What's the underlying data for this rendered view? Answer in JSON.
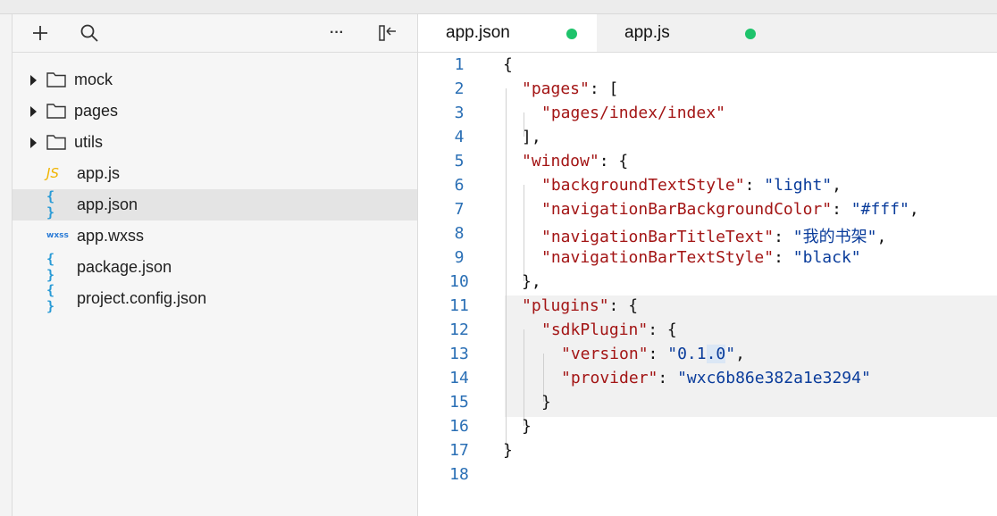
{
  "sidebar": {
    "toolbar": {
      "add_icon": "plus-icon",
      "search_icon": "search-icon",
      "more_label": "···",
      "collapse_label": "▯⇠"
    },
    "items": [
      {
        "label": "mock",
        "type": "folder"
      },
      {
        "label": "pages",
        "type": "folder"
      },
      {
        "label": "utils",
        "type": "folder"
      },
      {
        "label": "app.js",
        "type": "js",
        "icon_text": "JS"
      },
      {
        "label": "app.json",
        "type": "json",
        "icon_text": "{ }",
        "selected": true
      },
      {
        "label": "app.wxss",
        "type": "wxss",
        "icon_text": "wxss"
      },
      {
        "label": "package.json",
        "type": "json",
        "icon_text": "{ }"
      },
      {
        "label": "project.config.json",
        "type": "json",
        "icon_text": "{ }"
      }
    ]
  },
  "editor": {
    "tabs": [
      {
        "label": "app.json",
        "active": true,
        "modified": true
      },
      {
        "label": "app.js",
        "active": false,
        "modified": true
      }
    ],
    "lines": [
      {
        "n": "1",
        "text": "{"
      },
      {
        "n": "2",
        "text": "\"pages\": ["
      },
      {
        "n": "3",
        "text": "\"pages/index/index\""
      },
      {
        "n": "4",
        "text": "],"
      },
      {
        "n": "5",
        "text": "\"window\": {"
      },
      {
        "n": "6",
        "text": "\"backgroundTextStyle\": \"light\","
      },
      {
        "n": "7",
        "text": "\"navigationBarBackgroundColor\": \"#fff\","
      },
      {
        "n": "8",
        "text": "\"navigationBarTitleText\": \"我的书架\","
      },
      {
        "n": "9",
        "text": "\"navigationBarTextStyle\": \"black\""
      },
      {
        "n": "10",
        "text": "},"
      },
      {
        "n": "11",
        "text": "\"plugins\": {"
      },
      {
        "n": "12",
        "text": "\"sdkPlugin\": {"
      },
      {
        "n": "13",
        "text": "\"version\": \"0.1.0\","
      },
      {
        "n": "14",
        "text": "\"provider\": \"wxc6b86e382a1e3294\""
      },
      {
        "n": "15",
        "text": "}"
      },
      {
        "n": "16",
        "text": "}"
      },
      {
        "n": "17",
        "text": "}"
      },
      {
        "n": "18",
        "text": ""
      }
    ],
    "tokens": {
      "l1": "{",
      "l2k": "\"pages\"",
      "l2p": ": [",
      "l3s": "\"pages/index/index\"",
      "l4p": "],",
      "l5k": "\"window\"",
      "l5p": ": {",
      "l6k": "\"backgroundTextStyle\"",
      "l6p": ": ",
      "l6s": "\"light\"",
      "l6c": ",",
      "l7k": "\"navigationBarBackgroundColor\"",
      "l7p": ": ",
      "l7s": "\"#fff\"",
      "l7c": ",",
      "l8k": "\"navigationBarTitleText\"",
      "l8p": ": ",
      "l8s": "\"我的书架\"",
      "l8c": ",",
      "l9k": "\"navigationBarTextStyle\"",
      "l9p": ": ",
      "l9s": "\"black\"",
      "l10p": "},",
      "l11k": "\"plugins\"",
      "l11p": ": {",
      "l12k": "\"sdkPlugin\"",
      "l12p": ": {",
      "l13k": "\"version\"",
      "l13p": ": ",
      "l13s1": "\"0.1",
      "l13sel": ".0",
      "l13s2": "\"",
      "l13c": ",",
      "l14k": "\"provider\"",
      "l14p": ": ",
      "l14s": "\"wxc6b86e382a1e3294\"",
      "l15p": "}",
      "l16p": "}",
      "l17p": "}"
    }
  },
  "colors": {
    "key": "#a31515",
    "string": "#0a3c9b",
    "line_number": "#2a6fb5",
    "modified_dot": "#1ec36b",
    "js_icon": "#f0b400",
    "json_icon": "#2a9bd6"
  }
}
